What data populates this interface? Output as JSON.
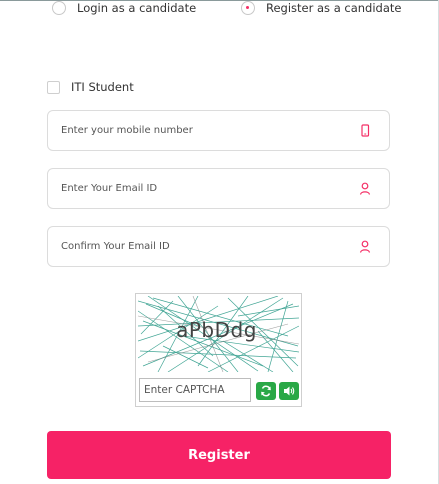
{
  "radios": {
    "login_label": "Login as a candidate",
    "register_label": "Register as a candidate",
    "selected": "register"
  },
  "checkbox": {
    "label": "ITI Student",
    "checked": false
  },
  "fields": {
    "mobile": {
      "placeholder": "Enter your mobile number",
      "icon": "mobile-icon"
    },
    "email": {
      "placeholder": "Enter Your Email ID",
      "icon": "user-icon"
    },
    "confirm_email": {
      "placeholder": "Confirm Your Email ID",
      "icon": "user-icon"
    }
  },
  "captcha": {
    "code": "aPbDdg",
    "input_placeholder": "Enter CAPTCHA",
    "refresh_icon": "refresh-icon",
    "audio_icon": "speaker-icon",
    "line_color": "#2e9c8a"
  },
  "register_button": {
    "label": "Register",
    "color": "#f62266"
  },
  "accent_color": "#f42f66"
}
